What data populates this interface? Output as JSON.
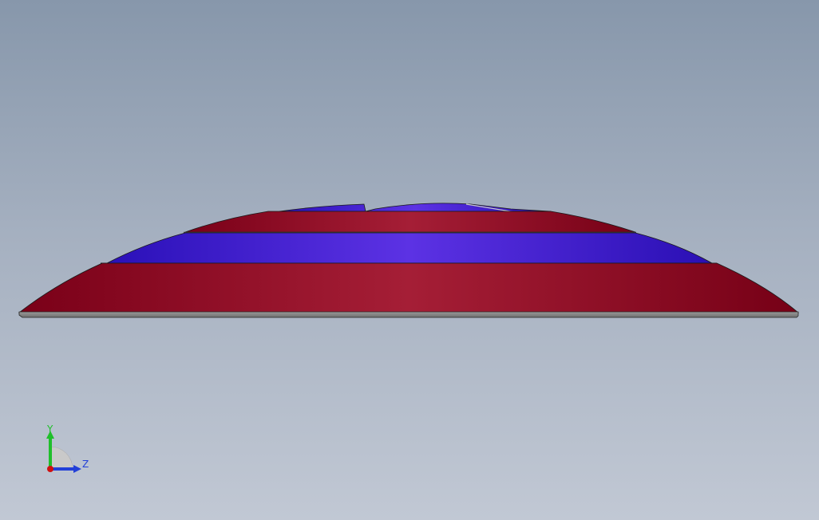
{
  "viewport": {
    "background_top": "#8797ab",
    "background_bottom": "#c1c8d4"
  },
  "model": {
    "colors": {
      "red_face": "#9e1a32",
      "red_shade": "#780016",
      "blue_face": "#5a30e0",
      "blue_shade": "#2a10b8",
      "base_plate": "#8c8c8c",
      "edge": "#1a1a1a"
    }
  },
  "triad": {
    "y_label": "Y",
    "z_label": "Z",
    "x_color": "#d01010",
    "y_color": "#1fbf2a",
    "z_color": "#2340d8"
  }
}
